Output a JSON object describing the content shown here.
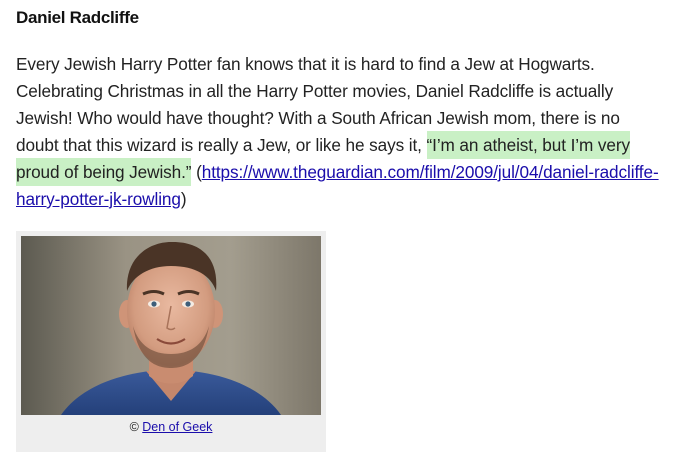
{
  "heading": "Daniel Radcliffe",
  "paragraph": {
    "text_before": "Every Jewish Harry Potter fan knows that it is hard to find a Jew at Hogwarts. Celebrating Christmas in all the Harry Potter movies, Daniel Radcliffe is actually Jewish! Who would have thought? With a South African Jewish mom, there is no doubt that this wizard is really a Jew, or like he says it, ",
    "quote": "“I’m an atheist, but I’m very proud of being Jewish.”",
    "paren_open": " (",
    "link_text": "https://www.theguardian.com/film/2009/jul/04/daniel-radcliffe-harry-potter-jk-rowling",
    "paren_close": ")"
  },
  "figure": {
    "copyright_symbol": "© ",
    "credit_link": "Den of Geek"
  },
  "colors": {
    "highlight": "#c9f0c5",
    "link": "#1a0dab",
    "caption_bg": "#eeeeee"
  }
}
